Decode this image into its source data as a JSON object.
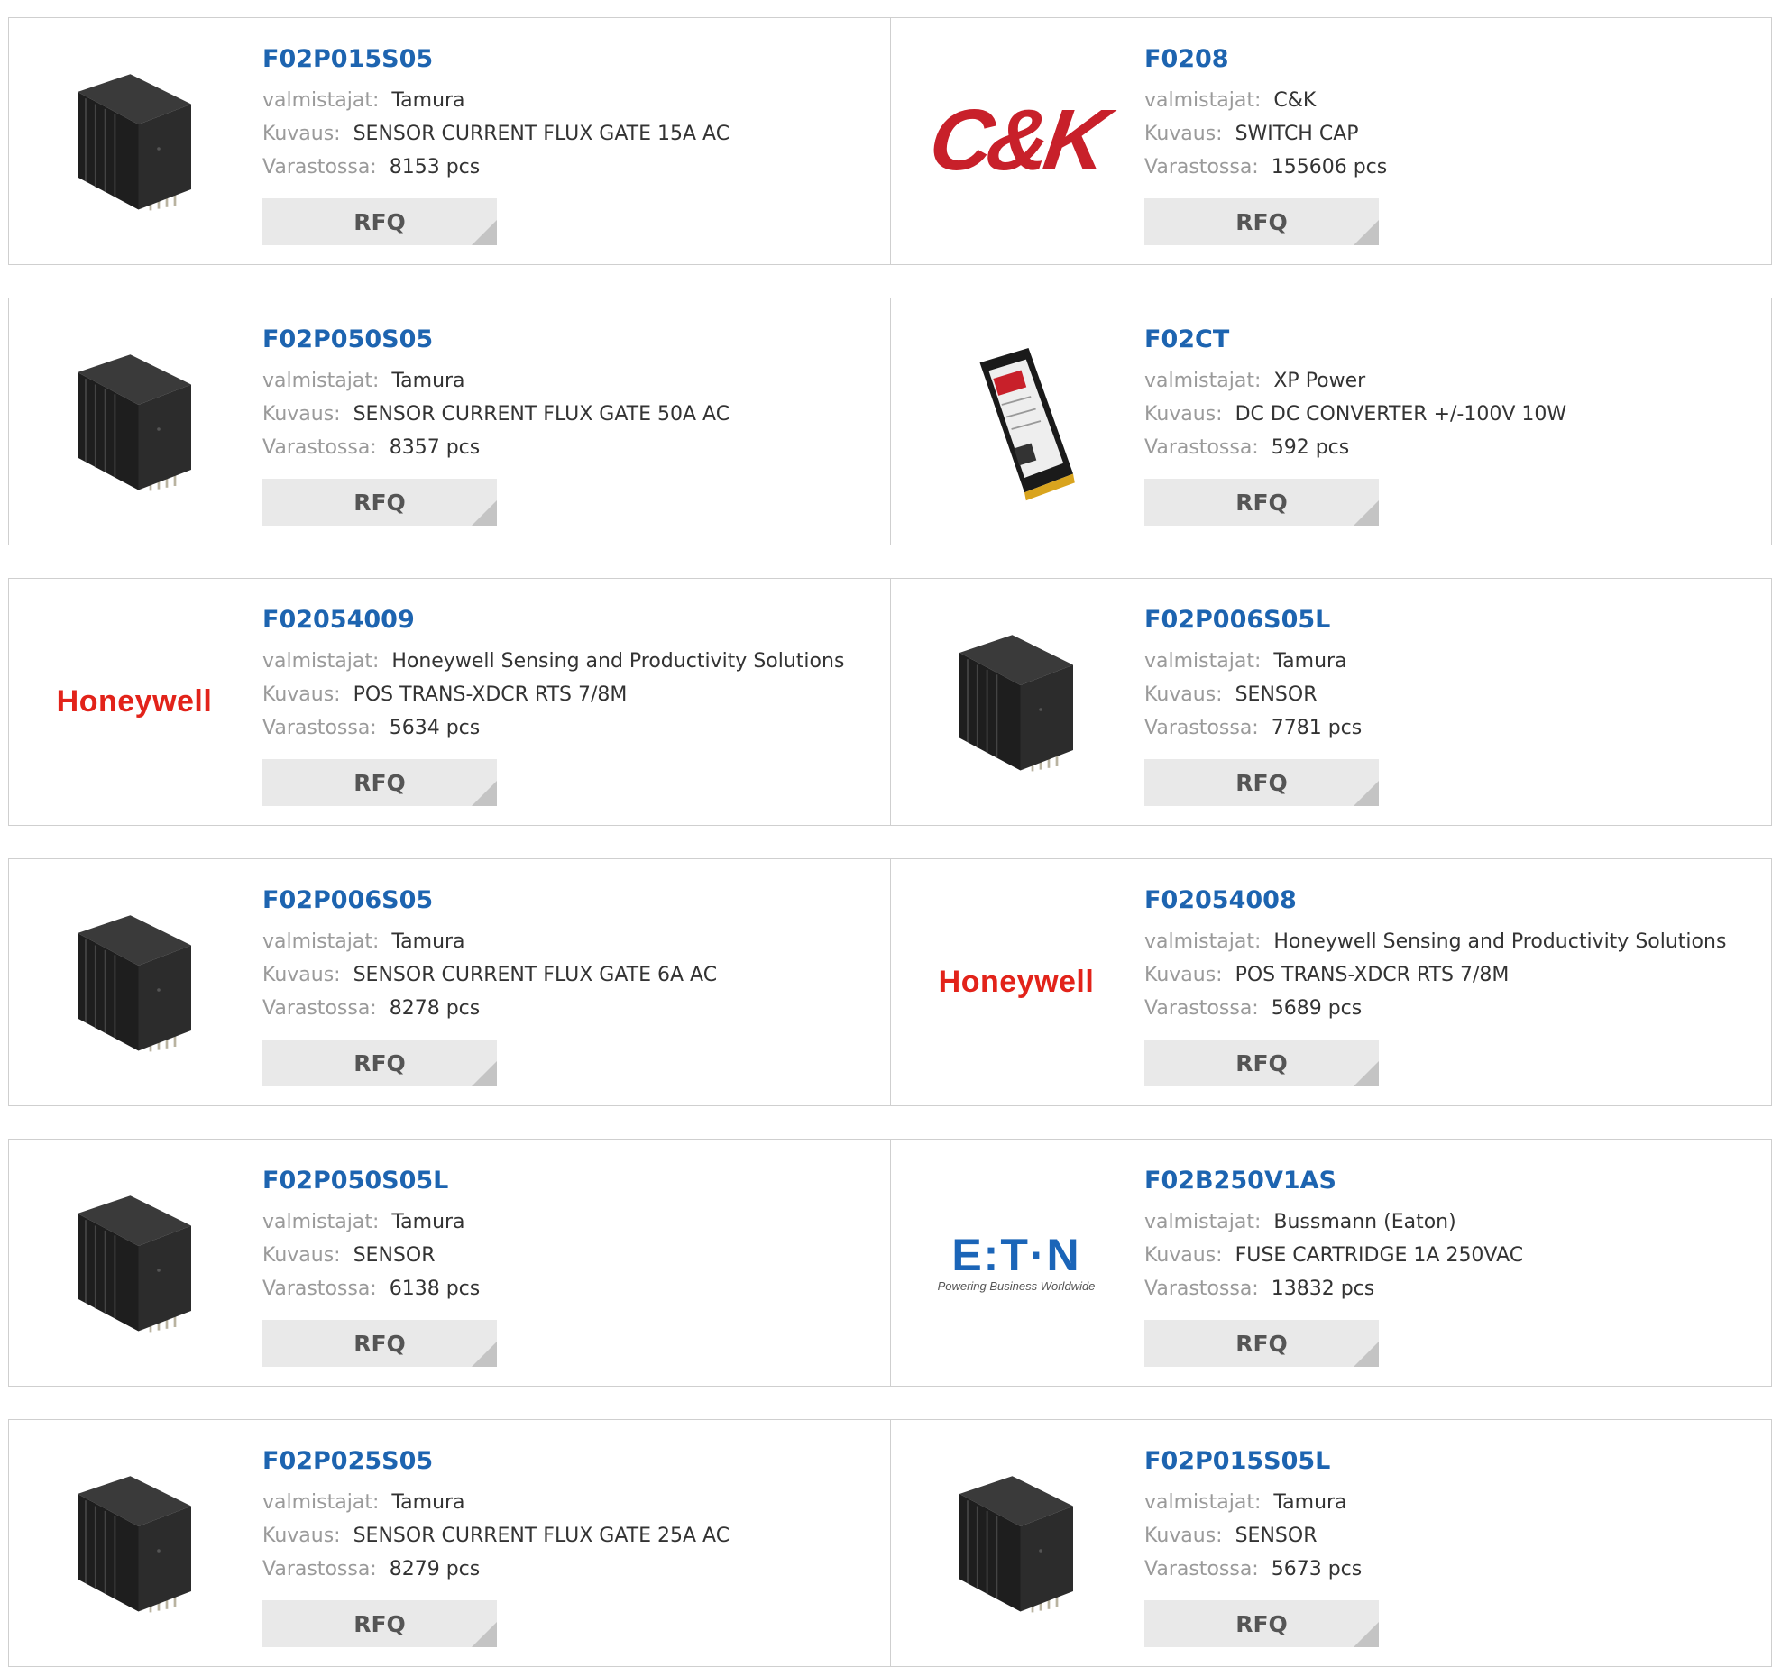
{
  "labels": {
    "manufacturer": "valmistajat:",
    "description": "Kuvaus:",
    "stock": "Varastossa:",
    "rfq": "RFQ"
  },
  "logos": {
    "ck": "C&K",
    "honeywell": "Honeywell",
    "eaton": "E:T·N",
    "eaton_tagline": "Powering Business Worldwide"
  },
  "products": [
    {
      "part": "F02P015S05",
      "manufacturer": "Tamura",
      "description": "SENSOR CURRENT FLUX GATE 15A AC",
      "stock": "8153 pcs",
      "image": "sensor-icon"
    },
    {
      "part": "F0208",
      "manufacturer": "C&K",
      "description": "SWITCH CAP",
      "stock": "155606 pcs",
      "image": "ck-logo"
    },
    {
      "part": "F02P050S05",
      "manufacturer": "Tamura",
      "description": "SENSOR CURRENT FLUX GATE 50A AC",
      "stock": "8357 pcs",
      "image": "sensor-icon"
    },
    {
      "part": "F02CT",
      "manufacturer": "XP Power",
      "description": "DC DC CONVERTER +/-100V 10W",
      "stock": "592 pcs",
      "image": "converter-icon"
    },
    {
      "part": "F02054009",
      "manufacturer": "Honeywell Sensing and Productivity Solutions",
      "description": "POS TRANS-XDCR RTS 7/8M",
      "stock": "5634 pcs",
      "image": "honeywell-logo"
    },
    {
      "part": "F02P006S05L",
      "manufacturer": "Tamura",
      "description": "SENSOR",
      "stock": "7781 pcs",
      "image": "sensor-icon"
    },
    {
      "part": "F02P006S05",
      "manufacturer": "Tamura",
      "description": "SENSOR CURRENT FLUX GATE 6A AC",
      "stock": "8278 pcs",
      "image": "sensor-icon"
    },
    {
      "part": "F02054008",
      "manufacturer": "Honeywell Sensing and Productivity Solutions",
      "description": "POS TRANS-XDCR RTS 7/8M",
      "stock": "5689 pcs",
      "image": "honeywell-logo"
    },
    {
      "part": "F02P050S05L",
      "manufacturer": "Tamura",
      "description": "SENSOR",
      "stock": "6138 pcs",
      "image": "sensor-icon"
    },
    {
      "part": "F02B250V1AS",
      "manufacturer": "Bussmann (Eaton)",
      "description": "FUSE CARTRIDGE 1A 250VAC",
      "stock": "13832 pcs",
      "image": "eaton-logo"
    },
    {
      "part": "F02P025S05",
      "manufacturer": "Tamura",
      "description": "SENSOR CURRENT FLUX GATE 25A AC",
      "stock": "8279 pcs",
      "image": "sensor-icon"
    },
    {
      "part": "F02P015S05L",
      "manufacturer": "Tamura",
      "description": "SENSOR",
      "stock": "5673 pcs",
      "image": "sensor-icon"
    }
  ]
}
